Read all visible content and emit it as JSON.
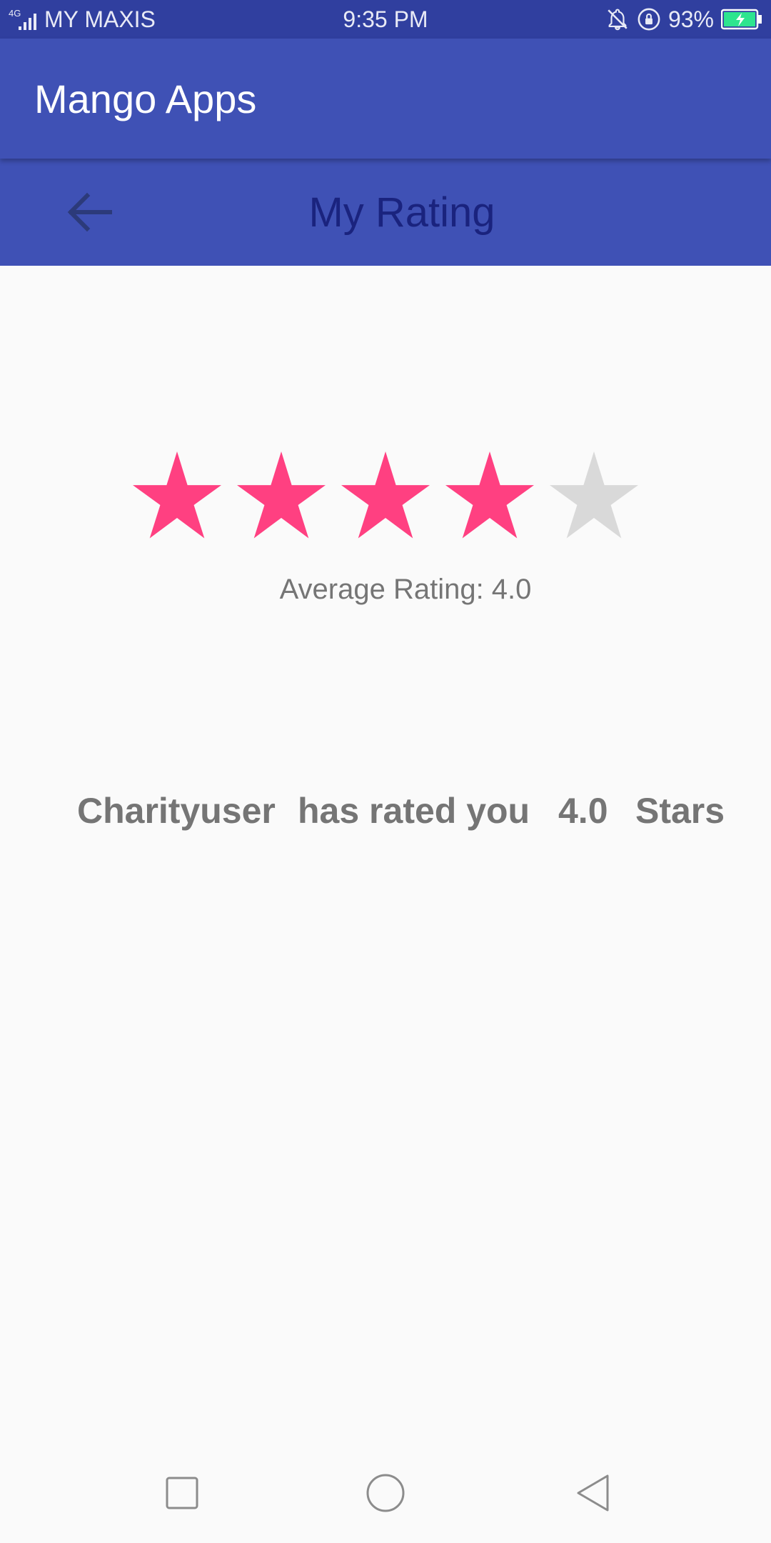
{
  "status_bar": {
    "network_type": "4G",
    "carrier": "MY MAXIS",
    "time": "9:35 PM",
    "battery_percent": "93%",
    "icons": [
      "signal-icon",
      "bell-off-icon",
      "rotation-lock-icon",
      "battery-charging-icon"
    ]
  },
  "app_bar": {
    "title": "Mango Apps"
  },
  "sub_header": {
    "title": "My Rating",
    "back_icon": "arrow-back-icon"
  },
  "rating": {
    "value": 4.0,
    "max": 5,
    "filled_color": "#ff4081",
    "empty_color": "#d9d9d9",
    "average_text": "Average Rating: 4.0"
  },
  "rated_line": {
    "user": "Charityuser",
    "middle": "has rated you",
    "value": "4.0",
    "suffix": "Stars"
  },
  "nav_bar": {
    "buttons": [
      "recent-apps-icon",
      "home-icon",
      "back-icon"
    ]
  },
  "colors": {
    "status_bar": "#303f9f",
    "primary": "#3f51b5",
    "title_dark": "#1a237e"
  }
}
